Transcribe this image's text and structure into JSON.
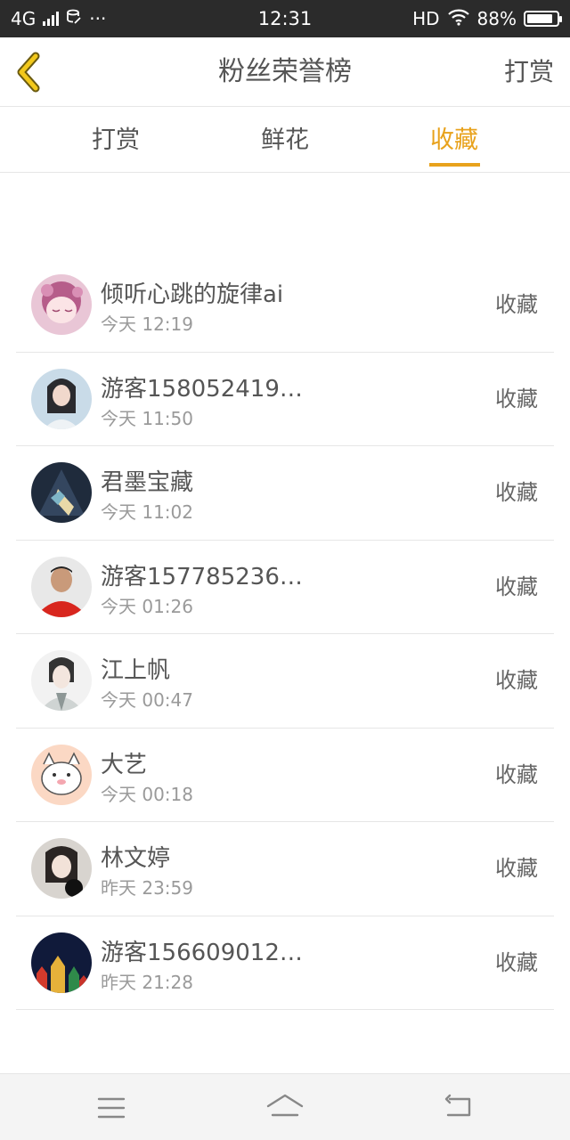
{
  "status_bar": {
    "network": "4G",
    "more": "···",
    "time": "12:31",
    "hd": "HD",
    "battery": "88%",
    "battery_level": 0.88
  },
  "header": {
    "title": "粉丝荣誉榜",
    "action": "打赏",
    "back_icon": "chevron-left-icon"
  },
  "tabs": [
    {
      "label": "打赏",
      "active": false
    },
    {
      "label": "鲜花",
      "active": false
    },
    {
      "label": "收藏",
      "active": true
    }
  ],
  "accent_color": "#e8a21c",
  "list": [
    {
      "name": "倾听心跳的旋律ai",
      "time": "今天 12:19",
      "action": "收藏"
    },
    {
      "name": "游客158052419…",
      "time": "今天 11:50",
      "action": "收藏"
    },
    {
      "name": "君墨宝藏",
      "time": "今天 11:02",
      "action": "收藏"
    },
    {
      "name": "游客157785236…",
      "time": "今天 01:26",
      "action": "收藏"
    },
    {
      "name": "江上帆",
      "time": "今天 00:47",
      "action": "收藏"
    },
    {
      "name": "大艺",
      "time": "今天 00:18",
      "action": "收藏"
    },
    {
      "name": "林文婷",
      "time": "昨天 23:59",
      "action": "收藏"
    },
    {
      "name": "游客156609012…",
      "time": "昨天 21:28",
      "action": "收藏"
    }
  ],
  "navbar": {
    "menu_icon": "menu-icon",
    "home_icon": "home-icon",
    "back_icon": "back-icon"
  }
}
